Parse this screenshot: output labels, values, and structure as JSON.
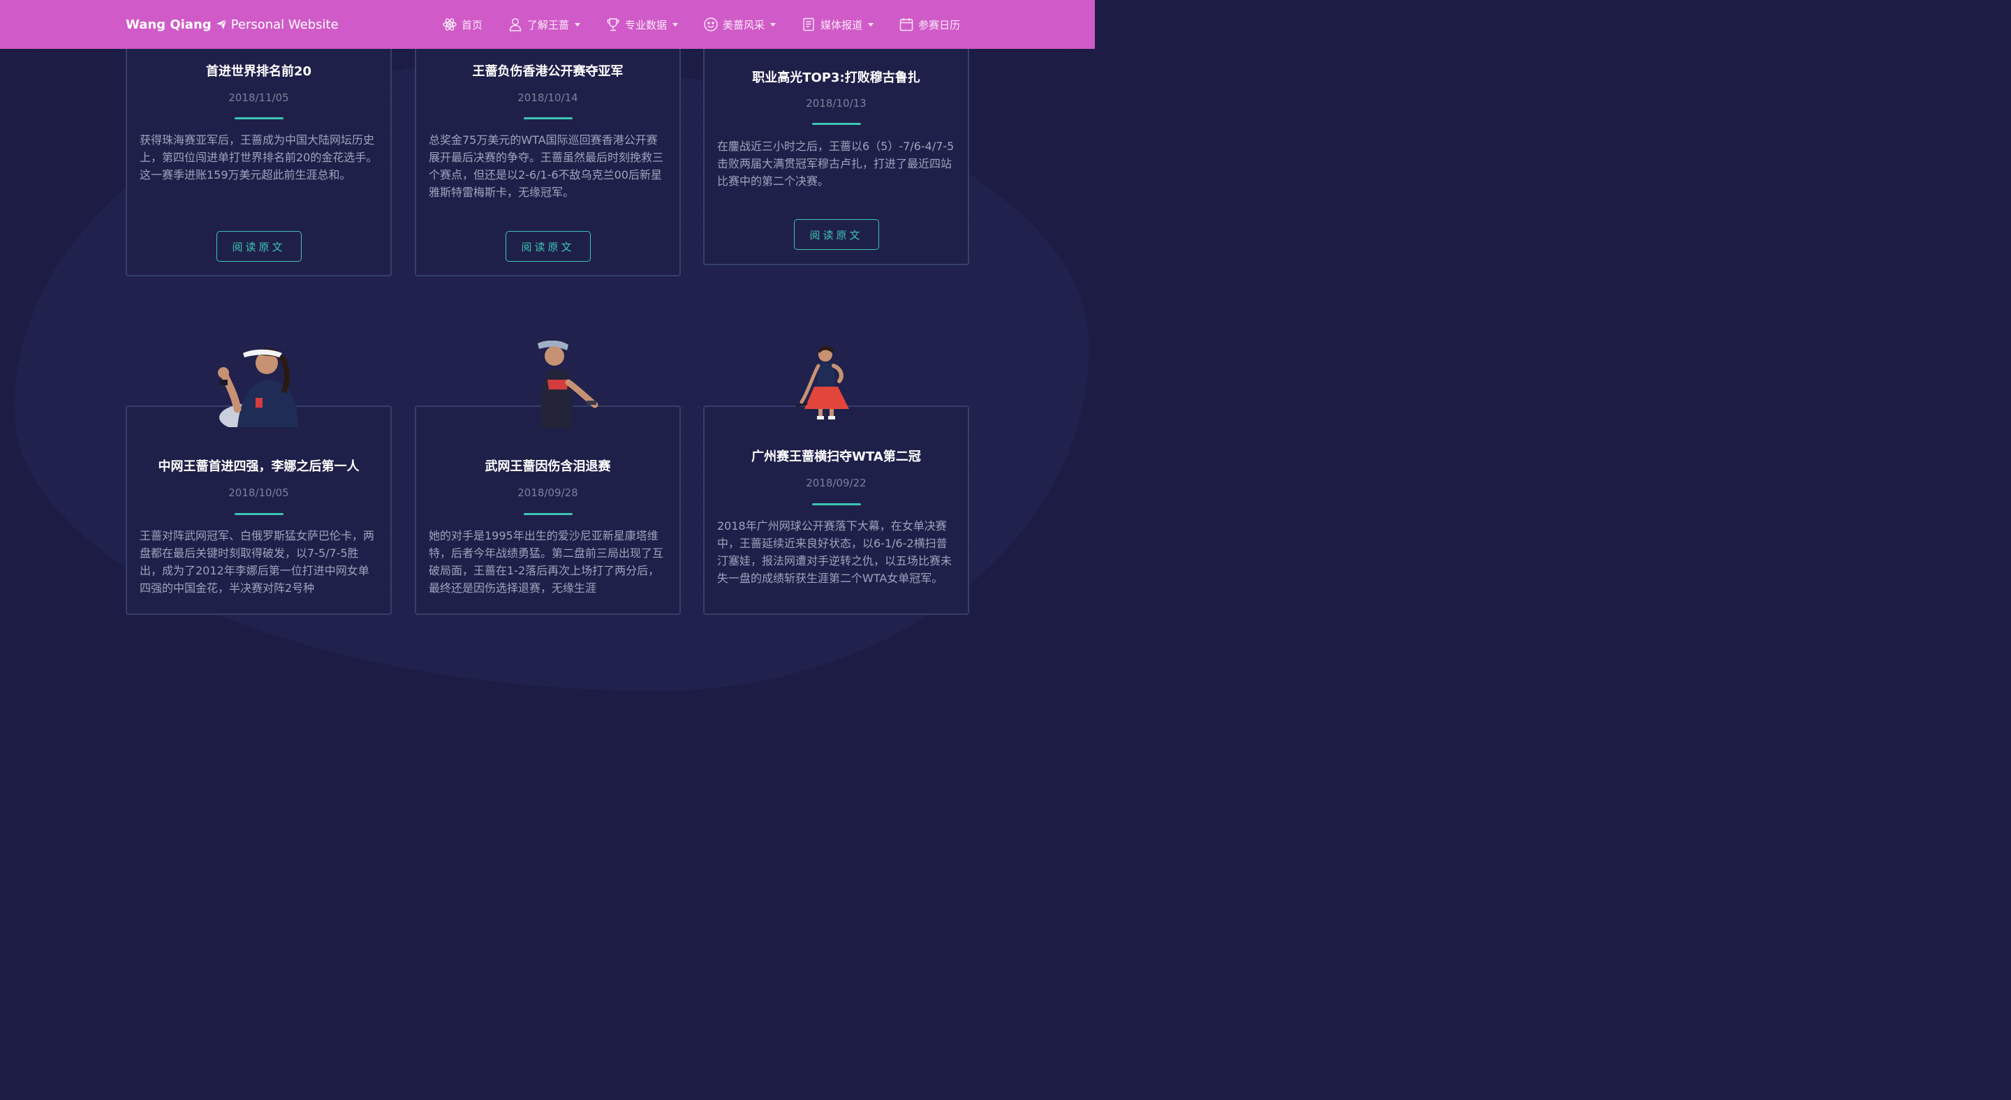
{
  "navbar": {
    "brand_bold": "Wang Qiang",
    "brand_light": "Personal Website",
    "items": [
      {
        "label": "首页",
        "icon": "atom-icon",
        "dropdown": false
      },
      {
        "label": "了解王蔷",
        "icon": "user-icon",
        "dropdown": true
      },
      {
        "label": "专业数据",
        "icon": "trophy-icon",
        "dropdown": true
      },
      {
        "label": "美蔷风采",
        "icon": "smile-icon",
        "dropdown": true
      },
      {
        "label": "媒体报道",
        "icon": "document-icon",
        "dropdown": true
      },
      {
        "label": "参赛日历",
        "icon": "calendar-icon",
        "dropdown": false
      }
    ]
  },
  "cards": [
    {
      "title": "首进世界排名前20",
      "date": "2018/11/05",
      "text": "获得珠海赛亚军后，王蔷成为中国大陆网坛历史上，第四位闯进单打世界排名前20的金花选手。这一赛季进账159万美元超此前生涯总和。",
      "button": "阅读原文"
    },
    {
      "title": "王蔷负伤香港公开赛夺亚军",
      "date": "2018/10/14",
      "text": "总奖金75万美元的WTA国际巡回赛香港公开赛展开最后决赛的争夺。王蔷虽然最后时刻挽救三个赛点，但还是以2-6/1-6不敌乌克兰00后新星雅斯特雷梅斯卡，无缘冠军。",
      "button": "阅读原文"
    },
    {
      "title": "职业高光TOP3:打败穆古鲁扎",
      "date": "2018/10/13",
      "text": "在鏖战近三小时之后，王蔷以6（5）-7/6-4/7-5击败两届大满贯冠军穆古卢扎，打进了最近四站比赛中的第二个决赛。",
      "button": "阅读原文"
    },
    {
      "title": "中网王蔷首进四强，李娜之后第一人",
      "date": "2018/10/05",
      "text": "王蔷对阵武网冠军、白俄罗斯猛女萨巴伦卡，两盘都在最后关键时刻取得破发，以7-5/7-5胜出，成为了2012年李娜后第一位打进中网女单四强的中国金花，半决赛对阵2号种"
    },
    {
      "title": "武网王蔷因伤含泪退赛",
      "date": "2018/09/28",
      "text": "她的对手是1995年出生的爱沙尼亚新星康塔维特，后者今年战绩勇猛。第二盘前三局出现了互破局面，王蔷在1-2落后再次上场打了两分后，最终还是因伤选择退赛，无缘生涯"
    },
    {
      "title": "广州赛王蔷横扫夺WTA第二冠",
      "date": "2018/09/22",
      "text": "2018年广州网球公开赛落下大幕，在女单决赛中，王蔷延续近来良好状态，以6-1/6-2横扫普汀塞娃，报法网遭对手逆转之仇，以五场比赛未失一盘的成绩斩获生涯第二个WTA女单冠军。"
    }
  ],
  "colors": {
    "navbar": "#d05bc8",
    "background": "#1c1c44",
    "accent": "#3ec4b4"
  }
}
